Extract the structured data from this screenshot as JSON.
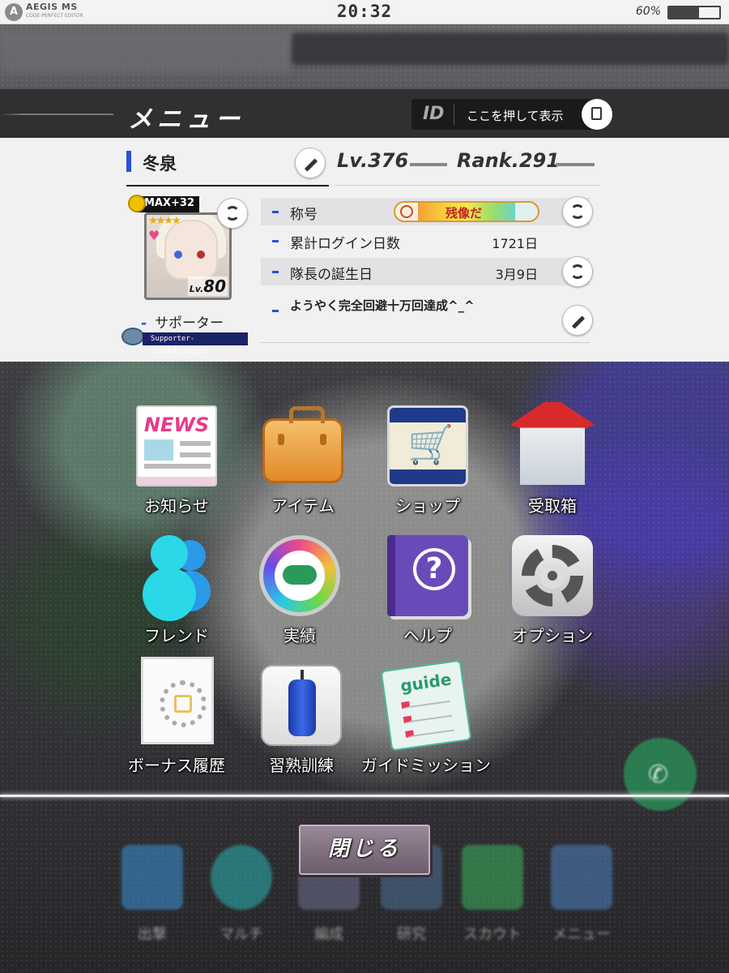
{
  "status_bar": {
    "app_name": "AEGIS MS",
    "app_sub": "CODE:PERFECT EDITOR",
    "time": "20:32",
    "battery_pct": "60%",
    "battery_level": 0.6
  },
  "header": {
    "title": "メニュー",
    "id_label": "ID",
    "id_placeholder": "ここを押して表示",
    "copy_icon": "copy-icon"
  },
  "profile": {
    "name": "冬泉",
    "level": "Lv.376",
    "rank": "Rank.291",
    "card": {
      "max_tag": "MAX+32",
      "stars": "★★★★",
      "level": "80",
      "level_prefix": "Lv."
    },
    "supporter_label": "サポーター",
    "plugin_name": "Supporter-SITARA.plugin",
    "rows": [
      {
        "label": "称号",
        "value": "",
        "badge": "残像だ"
      },
      {
        "label": "累計ログイン日数",
        "value": "1721日"
      },
      {
        "label": "隊長の誕生日",
        "value": "3月9日"
      }
    ],
    "comment": "ようやく完全回避十万回達成^_^"
  },
  "menu_items": [
    {
      "label": "お知らせ",
      "icon": "news-icon"
    },
    {
      "label": "アイテム",
      "icon": "briefcase-icon"
    },
    {
      "label": "ショップ",
      "icon": "shopping-cart-icon"
    },
    {
      "label": "受取箱",
      "icon": "gift-box-icon"
    },
    {
      "label": "フレンド",
      "icon": "friends-icon"
    },
    {
      "label": "実績",
      "icon": "gamepad-icon"
    },
    {
      "label": "ヘルプ",
      "icon": "help-book-icon"
    },
    {
      "label": "オプション",
      "icon": "gear-icon"
    },
    {
      "label": "ボーナス履歴",
      "icon": "bonus-history-icon"
    },
    {
      "label": "習熟訓練",
      "icon": "punching-bag-icon"
    },
    {
      "label": "ガイドミッション",
      "icon": "guide-clipboard-icon"
    }
  ],
  "close_label": "閉じる",
  "bottom_nav": [
    "出撃",
    "マルチ",
    "編成",
    "研究",
    "スカウト",
    "メニュー"
  ],
  "colors": {
    "accent_blue": "#2b4fd8",
    "header_bg": "#303032",
    "panel_bg": "#f1f1f1"
  }
}
